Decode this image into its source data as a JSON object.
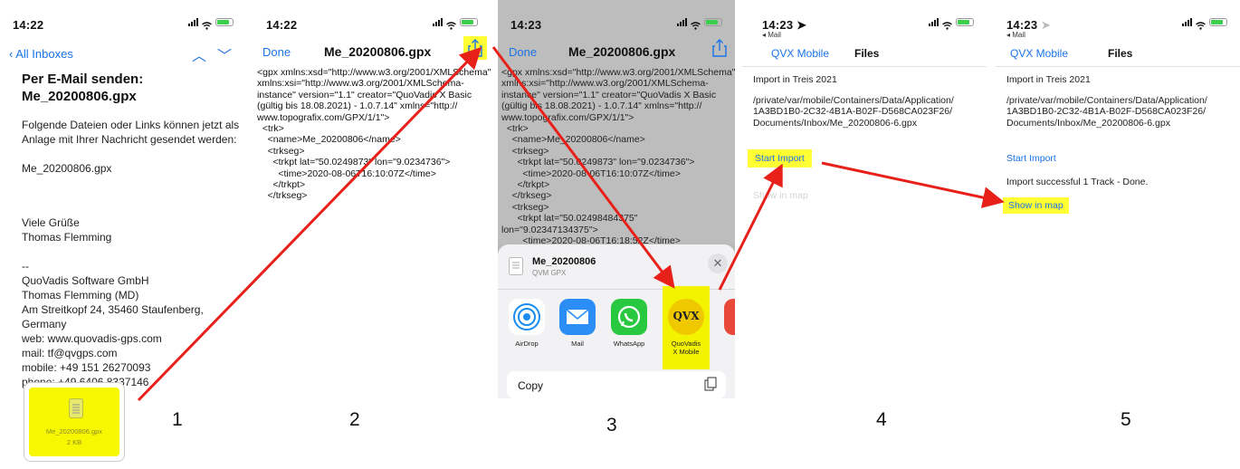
{
  "panel1": {
    "time": "14:22",
    "back_label": "All Inboxes",
    "subject_line1": "Per E-Mail senden:",
    "subject_line2": "Me_20200806.gpx",
    "body_intro1": "Folgende Dateien oder Links können jetzt als",
    "body_intro2": "Anlage mit Ihrer Nachricht gesendet werden:",
    "file_name": "Me_20200806.gpx",
    "greeting": "Viele Grüße",
    "sender": "Thomas Flemming",
    "sig_dash": "--",
    "sig_lines": [
      "QuoVadis Software GmbH",
      "Thomas Flemming (MD)",
      "Am Streitkopf 24, 35460 Staufenberg,",
      "Germany",
      "web: www.quovadis-gps.com",
      "mail: tf@qvgps.com",
      "mobile: +49 151 26270093",
      "phone: +49 6406 8337146"
    ],
    "attachment_name": "Me_20200806.gpx",
    "attachment_size": "2 KB"
  },
  "panel2": {
    "time": "14:22",
    "done_label": "Done",
    "title": "Me_20200806.gpx",
    "content": "<gpx xmlns:xsd=\"http://www.w3.org/2001/XMLSchema\"\nxmlns:xsi=\"http://www.w3.org/2001/XMLSchema-\ninstance\" version=\"1.1\" creator=\"QuoVadis X Basic\n(gültig bis 18.08.2021) - 1.0.7.14\" xmlns=\"http://\nwww.topografix.com/GPX/1/1\">\n  <trk>\n    <name>Me_20200806</name>\n    <trkseg>\n      <trkpt lat=\"50.0249873\" lon=\"9.0234736\">\n        <time>2020-08-06T16:10:07Z</time>\n      </trkpt>\n    </trkseg>"
  },
  "panel3": {
    "time": "14:23",
    "done_label": "Done",
    "title": "Me_20200806.gpx",
    "content": "<gpx xmlns:xsd=\"http://www.w3.org/2001/XMLSchema\"\nxmlns:xsi=\"http://www.w3.org/2001/XMLSchema-\ninstance\" version=\"1.1\" creator=\"QuoVadis X Basic\n(gültig bis 18.08.2021) - 1.0.7.14\" xmlns=\"http://\nwww.topografix.com/GPX/1/1\">\n  <trk>\n    <name>Me_20200806</name>\n    <trkseg>\n      <trkpt lat=\"50.0249873\" lon=\"9.0234736\">\n        <time>2020-08-06T16:10:07Z</time>\n      </trkpt>\n    </trkseg>\n    <trkseg>\n      <trkpt lat=\"50.02498484375\"\nlon=\"9.02347134375\">\n        <time>2020-08-06T16:18:52Z</time>",
    "share_file_name": "Me_20200806",
    "share_file_type": "QVM GPX",
    "apps": [
      {
        "label": "AirDrop",
        "label2": ""
      },
      {
        "label": "Mail",
        "label2": ""
      },
      {
        "label": "WhatsApp",
        "label2": ""
      },
      {
        "label": "QuoVadis",
        "label2": "X Mobile"
      }
    ],
    "qvx_logo_text": "QVX",
    "copy_label": "Copy"
  },
  "panel4": {
    "time": "14:23",
    "back_small": "◂ Mail",
    "back_label": "QVX Mobile",
    "title": "Files",
    "import_heading": "Import in Treis 2021",
    "path_lines": [
      "/private/var/mobile/Containers/Data/Application/",
      "1A3BD1B0-2C32-4B1A-B02F-D568CA023F26/",
      "Documents/Inbox/Me_20200806-6.gpx"
    ],
    "start_import": "Start Import",
    "show_in_map": "Show in map"
  },
  "panel5": {
    "time": "14:23",
    "back_small": "◂ Mail",
    "back_label": "QVX Mobile",
    "title": "Files",
    "import_heading": "Import in Treis 2021",
    "path_lines": [
      "/private/var/mobile/Containers/Data/Application/",
      "1A3BD1B0-2C32-4B1A-B02F-D568CA023F26/",
      "Documents/Inbox/Me_20200806-6.gpx"
    ],
    "start_import": "Start Import",
    "result": "Import successful 1 Track - Done.",
    "show_in_map": "Show in map"
  },
  "steps": [
    "1",
    "2",
    "3",
    "4",
    "5"
  ],
  "colors": {
    "link": "#1a73e8",
    "highlight": "#ffff33",
    "arrow": "#e8201a"
  }
}
